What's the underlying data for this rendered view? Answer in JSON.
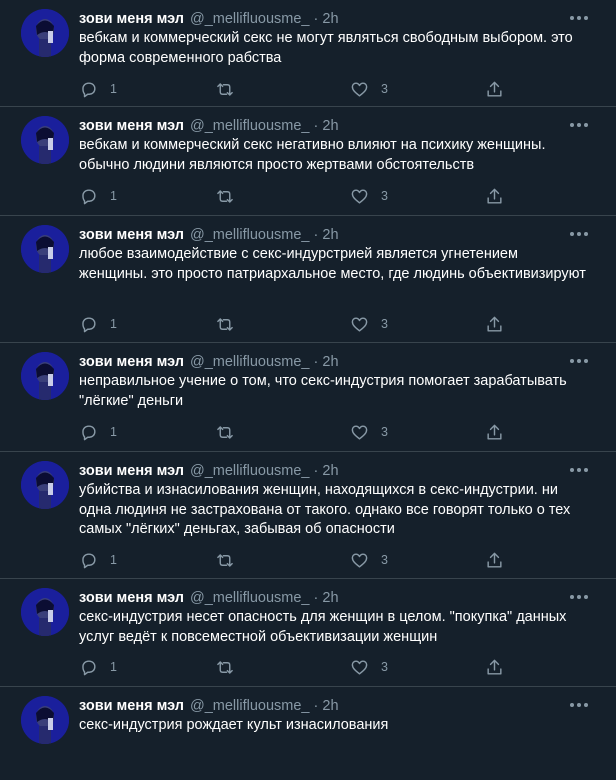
{
  "colors": {
    "background": "#15202b",
    "divider": "#38444d",
    "secondary_text": "#8899a6",
    "avatar_bg": "#1a1f9c"
  },
  "icons": {
    "reply": "reply-icon",
    "retweet": "retweet-icon",
    "like": "heart-icon",
    "share": "share-icon",
    "more": "more-icon"
  },
  "tweets": [
    {
      "name": "зови меня мэл",
      "handle": "@_mellifluousme_",
      "dot": "·",
      "time": "2h",
      "text": "вебкам и коммерческий секс не могут являться свободным выбором. это форма современного рабства",
      "replies": "1",
      "likes": "3"
    },
    {
      "name": "зови меня мэл",
      "handle": "@_mellifluousme_",
      "dot": "·",
      "time": "2h",
      "text": "вебкам и коммерческий секс негативно влияют на психику женщины. обычно людини являются просто жертвами обстоятельств",
      "replies": "1",
      "likes": "3"
    },
    {
      "name": "зови меня мэл",
      "handle": "@_mellifluousme_",
      "dot": "·",
      "time": "2h",
      "text": "любое взаимодействие с секс-индурстрией является угнетением женщины. это просто патриархальное место, где людинь объективизируют",
      "replies": "1",
      "likes": "3"
    },
    {
      "name": "зови меня мэл",
      "handle": "@_mellifluousme_",
      "dot": "·",
      "time": "2h",
      "text": "неправильное учение о том, что секс-индустрия помогает зарабатывать \"лёгкие\" деньги",
      "replies": "1",
      "likes": "3"
    },
    {
      "name": "зови меня мэл",
      "handle": "@_mellifluousme_",
      "dot": "·",
      "time": "2h",
      "text": "убийства и изнасилования женщин, находящихся в секс-индустрии. ни одна людиня не застрахована от такого. однако все говорят только о тех самых \"лёгких\" деньгах, забывая об опасности",
      "replies": "1",
      "likes": "3"
    },
    {
      "name": "зови меня мэл",
      "handle": "@_mellifluousme_",
      "dot": "·",
      "time": "2h",
      "text": "секс-индустрия несет опасность для женщин в целом. \"покупка\" данных услуг ведёт к повсеместной объективизации женщин",
      "replies": "1",
      "likes": "3"
    },
    {
      "name": "зови меня мэл",
      "handle": "@_mellifluousme_",
      "dot": "·",
      "time": "2h",
      "text": "секс-индустрия рождает культ изнасилования",
      "replies": "",
      "likes": ""
    }
  ]
}
